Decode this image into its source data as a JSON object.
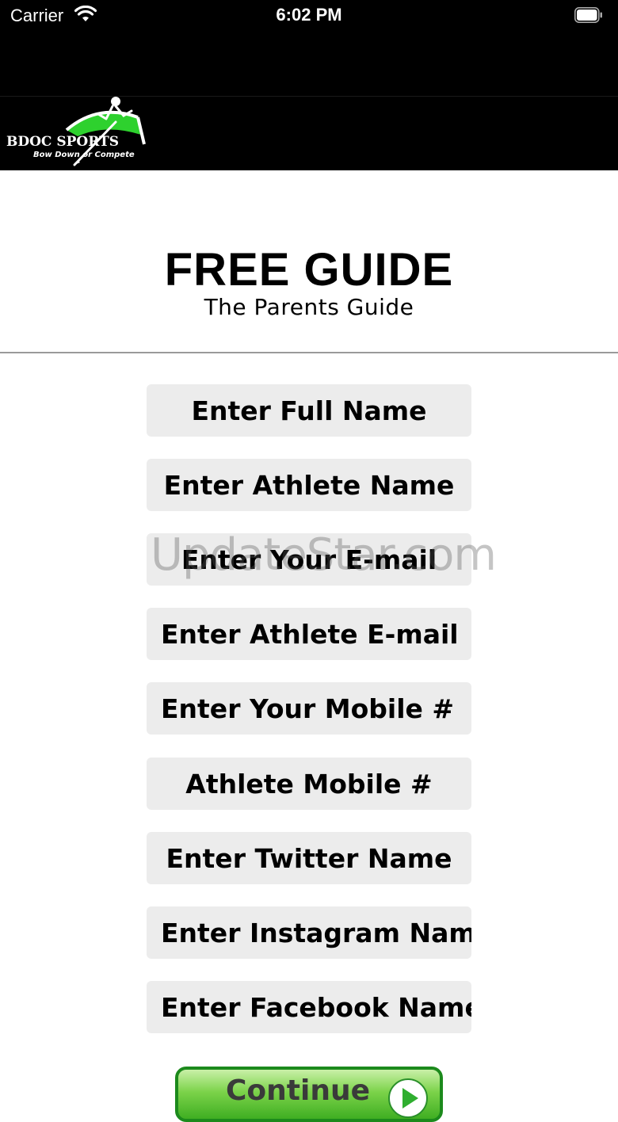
{
  "status_bar": {
    "carrier": "Carrier",
    "time": "6:02 PM"
  },
  "header": {
    "logo_icon": "bdoc-sports-logo",
    "logo_text": "BDOC SPORTS",
    "logo_tagline": "Bow Down or Compete",
    "accent_color": "#2ed12e"
  },
  "page": {
    "title": "FREE GUIDE",
    "subtitle": "The Parents Guide"
  },
  "form": {
    "fields": [
      {
        "placeholder": "Enter Full Name"
      },
      {
        "placeholder": "Enter Athlete Name"
      },
      {
        "placeholder": "Enter Your E-mail"
      },
      {
        "placeholder": "Enter Athlete E-mail"
      },
      {
        "placeholder": "Enter Your Mobile #"
      },
      {
        "placeholder": "Athlete Mobile #"
      },
      {
        "placeholder": "Enter Twitter Name"
      },
      {
        "placeholder": "Enter Instagram Name"
      },
      {
        "placeholder": "Enter Facebook Name"
      }
    ],
    "continue_label": "Continue",
    "continue_icon": "play-arrow-icon"
  },
  "watermark": "UpdateStar.com"
}
